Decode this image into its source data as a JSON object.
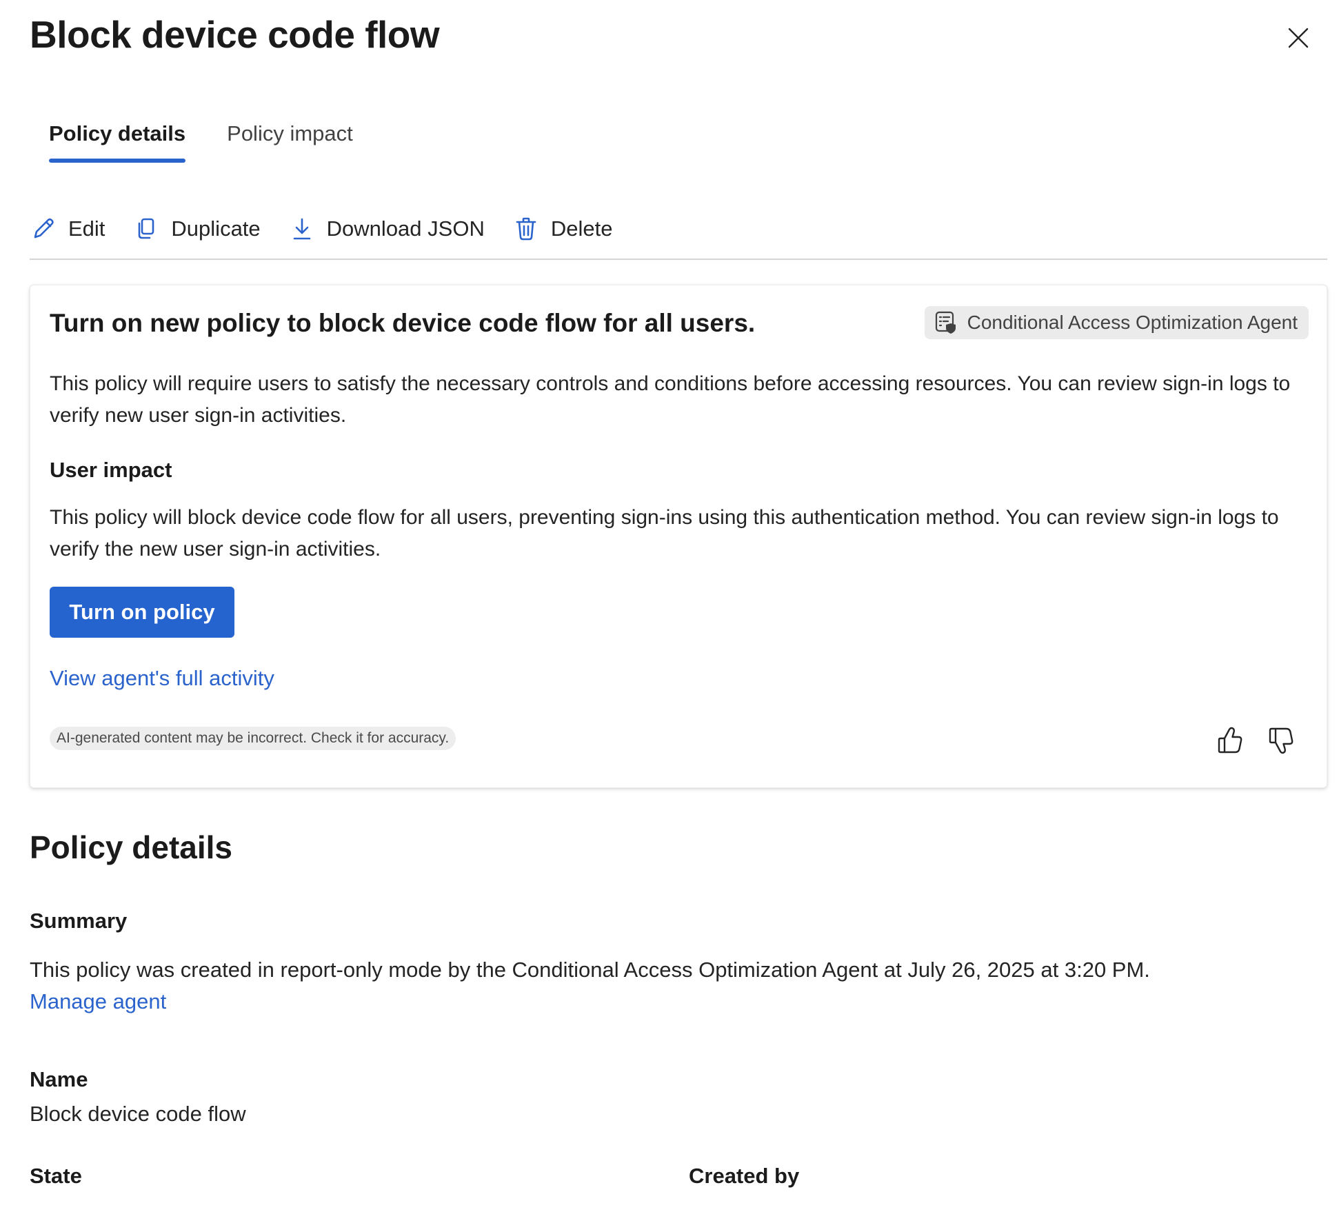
{
  "panel": {
    "title": "Block device code flow",
    "close_icon": "close-icon"
  },
  "tabs": [
    {
      "label": "Policy details",
      "active": true
    },
    {
      "label": "Policy impact",
      "active": false
    }
  ],
  "toolbar": {
    "edit": {
      "label": "Edit",
      "icon": "pencil-icon"
    },
    "duplicate": {
      "label": "Duplicate",
      "icon": "copy-icon"
    },
    "download": {
      "label": "Download JSON",
      "icon": "download-icon"
    },
    "delete": {
      "label": "Delete",
      "icon": "trash-icon"
    }
  },
  "recommendation": {
    "title": "Turn on new policy to block device code flow for all users.",
    "agent_badge": "Conditional Access Optimization Agent",
    "description": "This policy will require users to satisfy the necessary controls and conditions before accessing resources. You can review sign-in logs to verify new user sign-in activities.",
    "impact_heading": "User impact",
    "impact_text": "This policy will block device code flow for all users, preventing sign-ins using this authentication method. You can review sign-in logs to verify the new user sign-in activities.",
    "primary_button": "Turn on policy",
    "activity_link": "View agent's full activity",
    "disclaimer": "AI-generated content may be incorrect. Check it for accuracy."
  },
  "details": {
    "section_title": "Policy details",
    "summary_label": "Summary",
    "summary_text": "This policy was created in report-only mode by the Conditional Access Optimization Agent at July 26, 2025 at 3:20 PM.",
    "manage_agent_link": "Manage agent",
    "name_label": "Name",
    "name_value": "Block device code flow",
    "state_label": "State",
    "created_by_label": "Created by"
  },
  "colors": {
    "accent": "#2563cf",
    "link": "#2b63cc",
    "text": "#242424",
    "divider": "#d4d4d4"
  }
}
